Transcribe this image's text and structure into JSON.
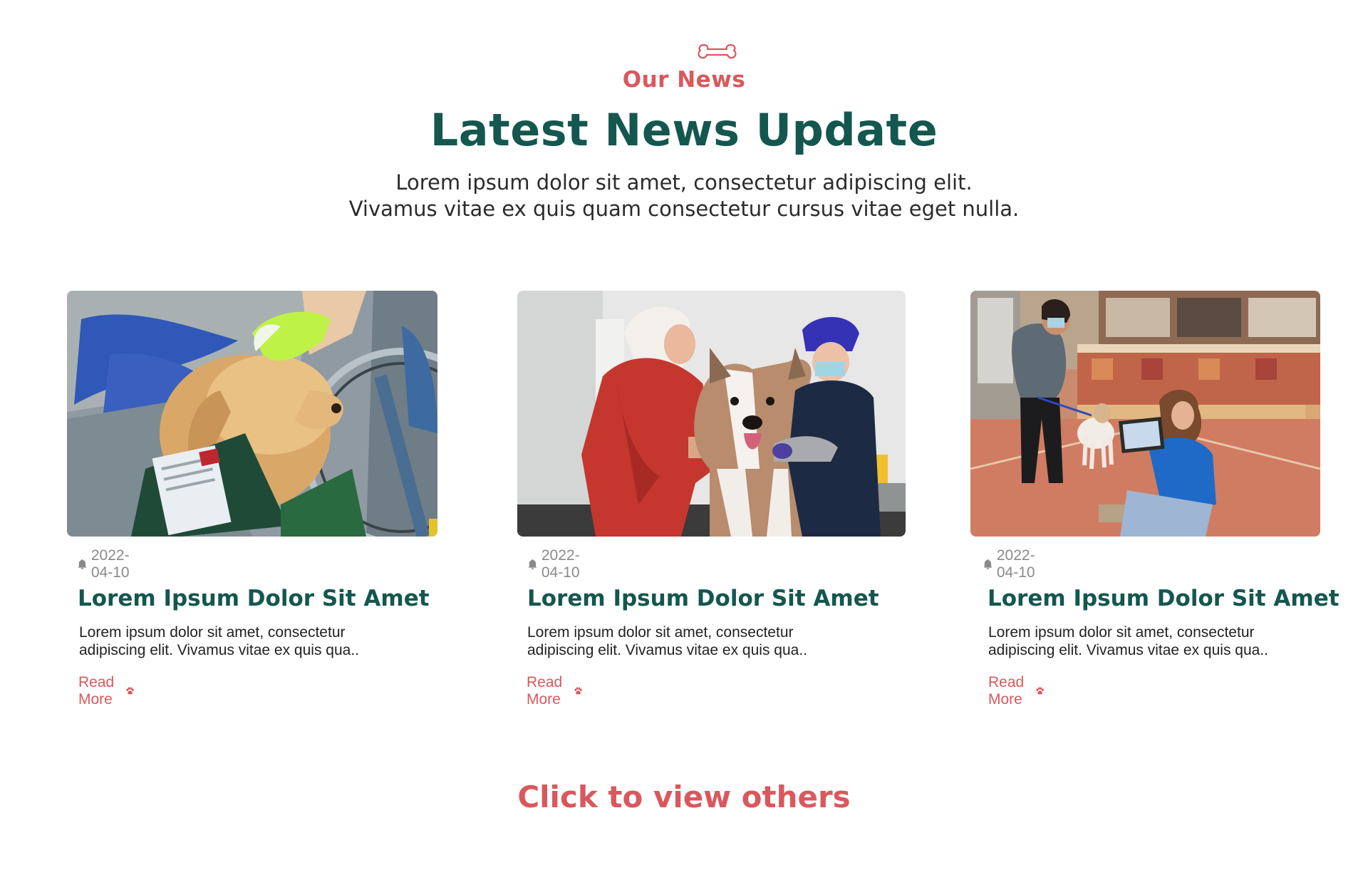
{
  "section": {
    "eyebrow": "Our News",
    "headline": "Latest News Update",
    "intro_line1": "Lorem ipsum dolor sit amet, consectetur adipiscing elit.",
    "intro_line2": "Vivamus vitae ex quis quam consectetur cursus vitae eget nulla."
  },
  "cards": [
    {
      "date": "2022-04-10",
      "title": "Lorem Ipsum Dolor Sit Amet",
      "excerpt": "Lorem ipsum dolor sit amet, consectetur adipiscing elit. Vivamus vitae ex quis qua..",
      "read_more": "Read More"
    },
    {
      "date": "2022-04-10",
      "title": "Lorem Ipsum Dolor Sit Amet",
      "excerpt": "Lorem ipsum dolor sit amet, consectetur adipiscing elit. Vivamus vitae ex quis qua..",
      "read_more": "Read More"
    },
    {
      "date": "2022-04-10",
      "title": "Lorem Ipsum Dolor Sit Amet",
      "excerpt": "Lorem ipsum dolor sit amet, consectetur adipiscing elit. Vivamus vitae ex quis qua..",
      "read_more": "Read More"
    }
  ],
  "cta_label": "Click to view others",
  "icons": {
    "header": "bone-icon",
    "date": "bell-icon",
    "read_more": "paw-icon"
  },
  "colors": {
    "accent": "#d9585e",
    "brand": "#14574f",
    "muted": "#8a8a8a"
  }
}
